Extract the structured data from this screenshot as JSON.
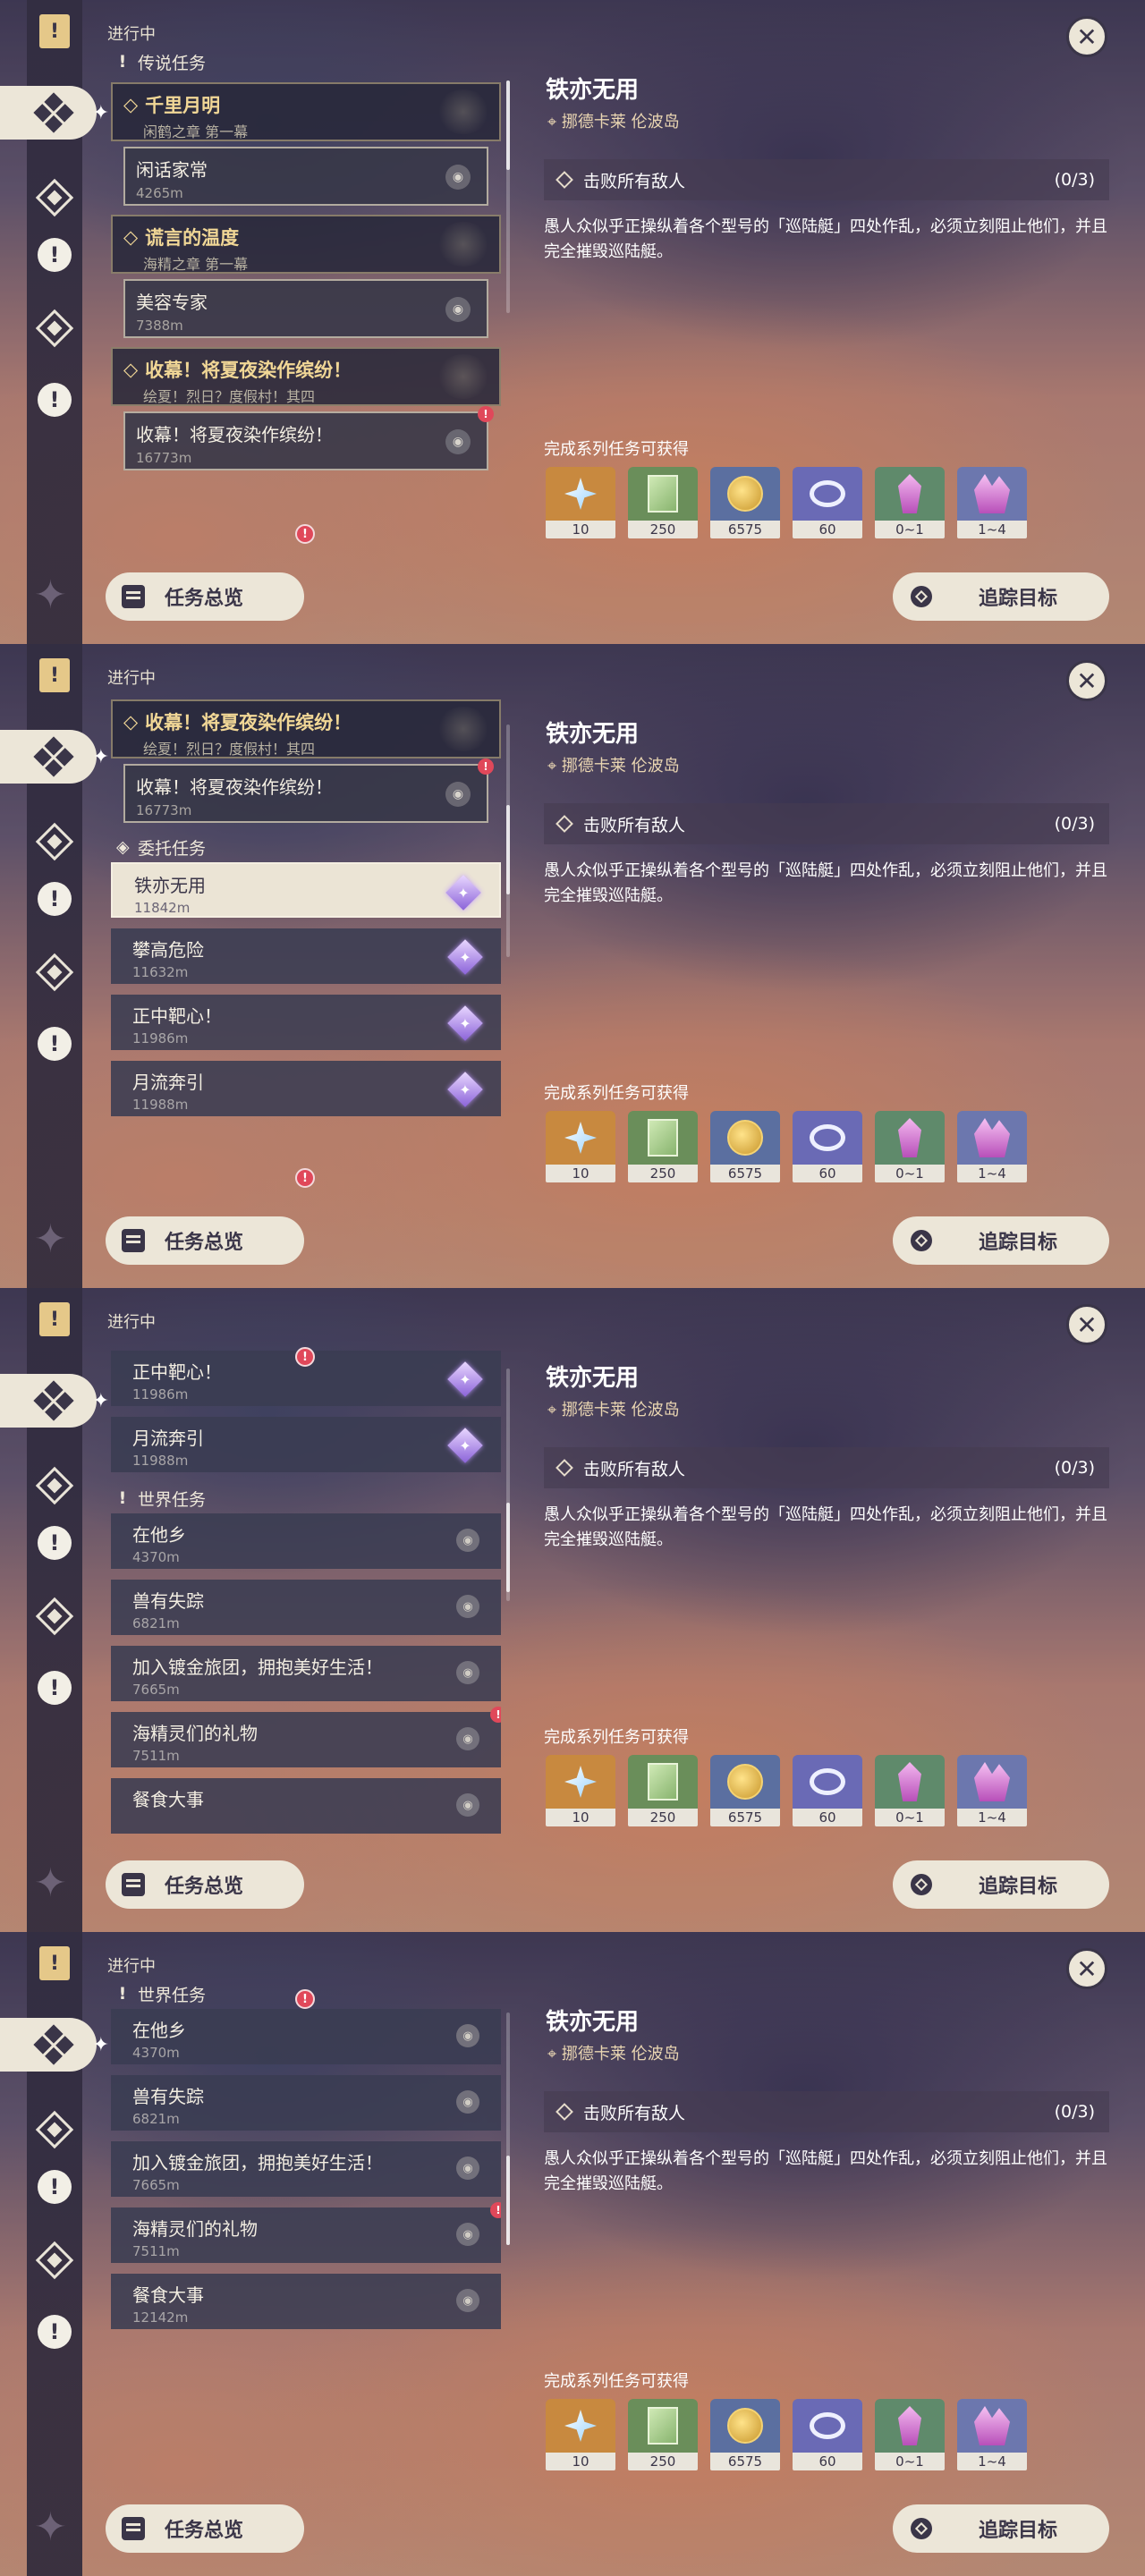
{
  "header": {
    "ongoing": "进行中"
  },
  "categories": {
    "legend": "传说任务",
    "commission": "委托任务",
    "world": "世界任务"
  },
  "legend_quests": [
    {
      "title": "千里月明",
      "chapter": "闲鹤之章 第一幕",
      "sub_title": "闲话家常",
      "sub_dist": "4265m"
    },
    {
      "title": "谎言的温度",
      "chapter": "海精之章 第一幕",
      "sub_title": "美容专家",
      "sub_dist": "7388m"
    },
    {
      "title": "收幕！将夏夜染作缤纷！",
      "chapter": "绘夏！烈日？度假村！其四",
      "sub_title": "收幕！将夏夜染作缤纷！",
      "sub_dist": "16773m"
    }
  ],
  "commissions": [
    {
      "title": "铁亦无用",
      "dist": "11842m"
    },
    {
      "title": "攀高危险",
      "dist": "11632m"
    },
    {
      "title": "正中靶心！",
      "dist": "11986m"
    },
    {
      "title": "月流奔引",
      "dist": "11988m"
    }
  ],
  "world_quests": [
    {
      "title": "在他乡",
      "dist": "4370m"
    },
    {
      "title": "兽有失踪",
      "dist": "6821m"
    },
    {
      "title": "加入镀金旅团，拥抱美好生活！",
      "dist": "7665m"
    },
    {
      "title": "海精灵们的礼物",
      "dist": "7511m"
    },
    {
      "title": "餐食大事",
      "dist": "12142m"
    }
  ],
  "detail": {
    "title": "铁亦无用",
    "location": "挪德卡莱 伦波岛",
    "objective": "击败所有敌人",
    "progress": "(0/3)",
    "description": "愚人众似乎正操纵着各个型号的「巡陆艇」四处作乱，必须立刻阻止他们，并且完全摧毁巡陆艇。",
    "rewards_title": "完成系列任务可获得",
    "rewards": [
      {
        "icon": "primogem-icon",
        "value": "10",
        "bg": "#c8893f"
      },
      {
        "icon": "adventure-exp-icon",
        "value": "250",
        "bg": "#6a8e5a"
      },
      {
        "icon": "mora-coin-icon",
        "value": "6575",
        "bg": "#5b6fa0"
      },
      {
        "icon": "companionship-icon",
        "value": "60",
        "bg": "#6a6ab5"
      },
      {
        "icon": "crystal-icon",
        "value": "0~1",
        "bg": "#5f8a6b"
      },
      {
        "icon": "crystal-cluster-icon",
        "value": "1~4",
        "bg": "#6c77ae"
      }
    ]
  },
  "buttons": {
    "overview": "任务总览",
    "track": "追踪目标"
  }
}
